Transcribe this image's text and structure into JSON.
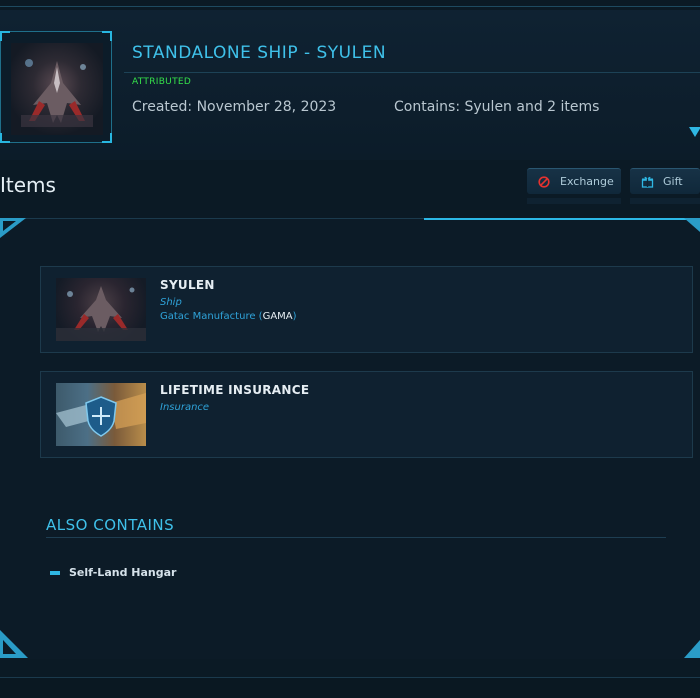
{
  "header": {
    "title": "STANDALONE SHIP - SYULEN",
    "attribution": "ATTRIBUTED",
    "created": "Created: November 28, 2023",
    "contains": "Contains: Syulen and 2 items"
  },
  "items_section": {
    "heading": "Items",
    "actions": {
      "exchange_label": "Exchange",
      "gift_label": "Gift"
    }
  },
  "items": [
    {
      "name": "SYULEN",
      "type": "Ship",
      "manufacturer": "Gatac Manufacture",
      "manufacturer_code": "GAMA"
    },
    {
      "name": "LIFETIME INSURANCE",
      "type": "Insurance"
    }
  ],
  "also_contains": {
    "title": "ALSO CONTAINS",
    "items": [
      "Self-Land Hangar"
    ]
  },
  "colors": {
    "accent": "#3fc1ea",
    "attributed": "#35e04a",
    "background": "#0b1a25"
  }
}
